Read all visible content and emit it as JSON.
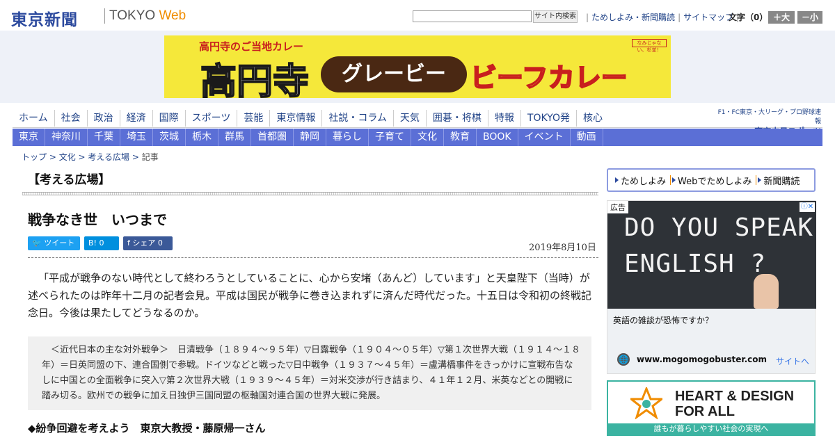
{
  "header": {
    "logo_ja": "東京新聞",
    "logo_tokyo": "TOKYO",
    "logo_web": "Web",
    "search_button": "サイト内検索",
    "links": [
      "ためしよみ・新聞購読",
      "サイトマップ"
    ],
    "font_size_label": "文字（0）",
    "font_bigger": "＋大",
    "font_smaller": "－小"
  },
  "banner": {
    "top_text": "高円寺のご当地カレー",
    "big_text": "高円寺",
    "pill_text": "グレービー",
    "red_text": "ビーフカレー",
    "badge_text": "なみじゃない、杉並！"
  },
  "nav_main": [
    "ホーム",
    "社会",
    "政治",
    "経済",
    "国際",
    "スポーツ",
    "芸能",
    "東京情報",
    "社説・コラム",
    "天気",
    "囲碁・将棋",
    "特報",
    "TOKYO発",
    "核心"
  ],
  "chunichi": {
    "small": "F1・FC東京・大リーグ・プロ野球速報",
    "big": "東京中日スポーツ"
  },
  "nav_sub": [
    "東京",
    "神奈川",
    "千葉",
    "埼玉",
    "茨城",
    "栃木",
    "群馬",
    "首都圏",
    "静岡",
    "暮らし",
    "子育て",
    "文化",
    "教育",
    "BOOK",
    "イベント",
    "動画"
  ],
  "breadcrumb": {
    "items": [
      "トップ",
      "文化",
      "考える広場"
    ],
    "current": "記事"
  },
  "article": {
    "section": "【考える広場】",
    "headline": "戦争なき世　いつまで",
    "share": {
      "tweet": "ツイート",
      "hatena": "B! 0",
      "facebook": "シェア 0"
    },
    "date": "2019年8月10日",
    "lead": "「平成が戦争のない時代として終わろうとしていることに、心から安堵（あんど）しています」と天皇陛下（当時）が述べられたのは昨年十二月の記者会見。平成は国民が戦争に巻き込まれずに済んだ時代だった。十五日は令和初の終戦記念日。今後は果たしてどうなるのか。",
    "note": "＜近代日本の主な対外戦争＞　日清戦争（１８９４～９５年）▽日露戦争（１９０４～０５年）▽第１次世界大戦（１９１４～１８年）＝日英同盟の下、連合国側で参戦。ドイツなどと戦った▽日中戦争（１９３７～４５年）＝盧溝橋事件をきっかけに宣戦布告なしに中国との全面戦争に突入▽第２次世界大戦（１９３９～４５年）＝対米交渉が行き詰まり、４１年１２月、米英などとの開戦に踏み切る。欧州での戦争に加え日独伊三国同盟の枢軸国対連合国の世界大戦に発展。",
    "subhead": "◆紛争回避を考えよう　東京大教授・藤原帰一さん"
  },
  "sidebar": {
    "links": [
      "ためしよみ",
      "Webでためしよみ",
      "新聞購読"
    ],
    "ad1": {
      "tag": "広告",
      "chalk_line1": "DO YOU SPEAK",
      "chalk_line2": "ENGLISH ?",
      "text": "英語の雑談が恐怖ですか？",
      "url": "www.mogomogobuster.com",
      "site_link": "サイトへ"
    },
    "ad2": {
      "line1": "HEART & DESIGN",
      "line2": "FOR ALL",
      "bar": "誰もが暮らしやすい社会の実現へ"
    }
  }
}
